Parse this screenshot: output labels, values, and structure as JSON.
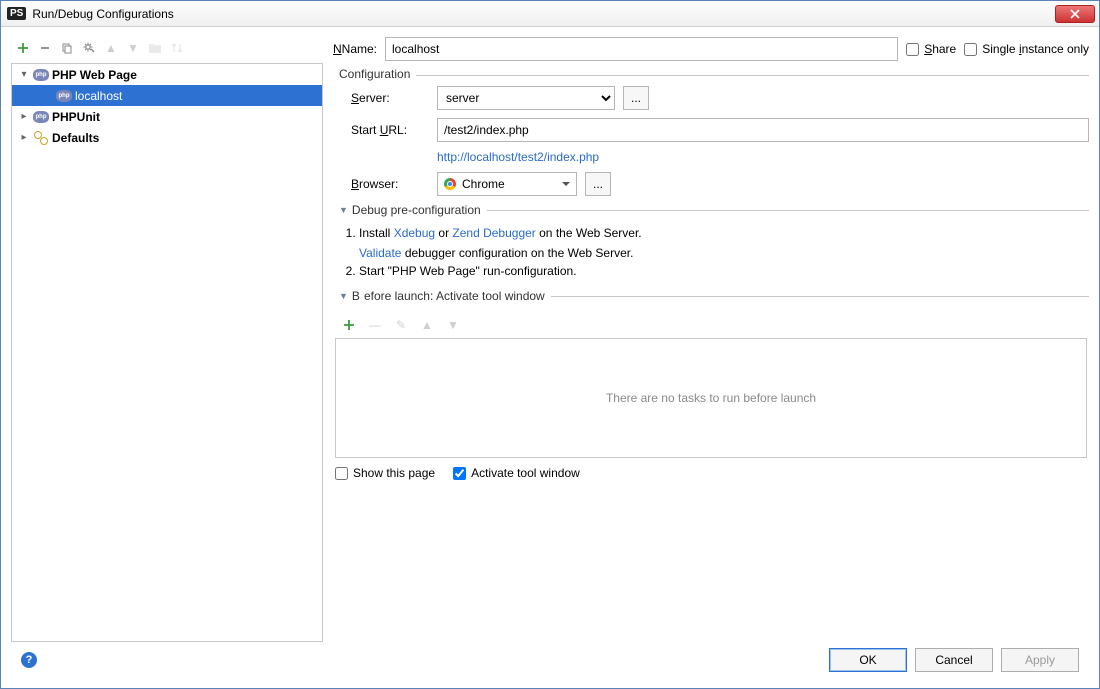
{
  "window": {
    "title": "Run/Debug Configurations"
  },
  "name": {
    "label": "Name:",
    "value": "localhost"
  },
  "share": {
    "label": "Share"
  },
  "single_instance": {
    "label": "Single instance only"
  },
  "tree": {
    "php_web": "PHP Web Page",
    "localhost": "localhost",
    "phpunit": "PHPUnit",
    "defaults": "Defaults"
  },
  "config": {
    "legend": "Configuration",
    "server_label": "Server:",
    "server_value": "server",
    "start_url_label": "Start URL:",
    "start_url_value": "/test2/index.php",
    "resolved_url": "http://localhost/test2/index.php",
    "browser_label": "Browser:",
    "browser_value": "Chrome"
  },
  "debug": {
    "legend": "Debug pre-configuration",
    "install_prefix": "Install ",
    "xdebug": "Xdebug",
    "or": " or ",
    "zend": "Zend Debugger",
    "install_suffix": " on the Web Server.",
    "validate": "Validate",
    "validate_suffix": " debugger configuration on the Web Server.",
    "step2": "Start \"PHP Web Page\" run-configuration."
  },
  "before": {
    "legend": "Before launch: Activate tool window",
    "empty": "There are no tasks to run before launch",
    "show_page": "Show this page",
    "activate": "Activate tool window"
  },
  "buttons": {
    "ok": "OK",
    "cancel": "Cancel",
    "apply": "Apply"
  }
}
